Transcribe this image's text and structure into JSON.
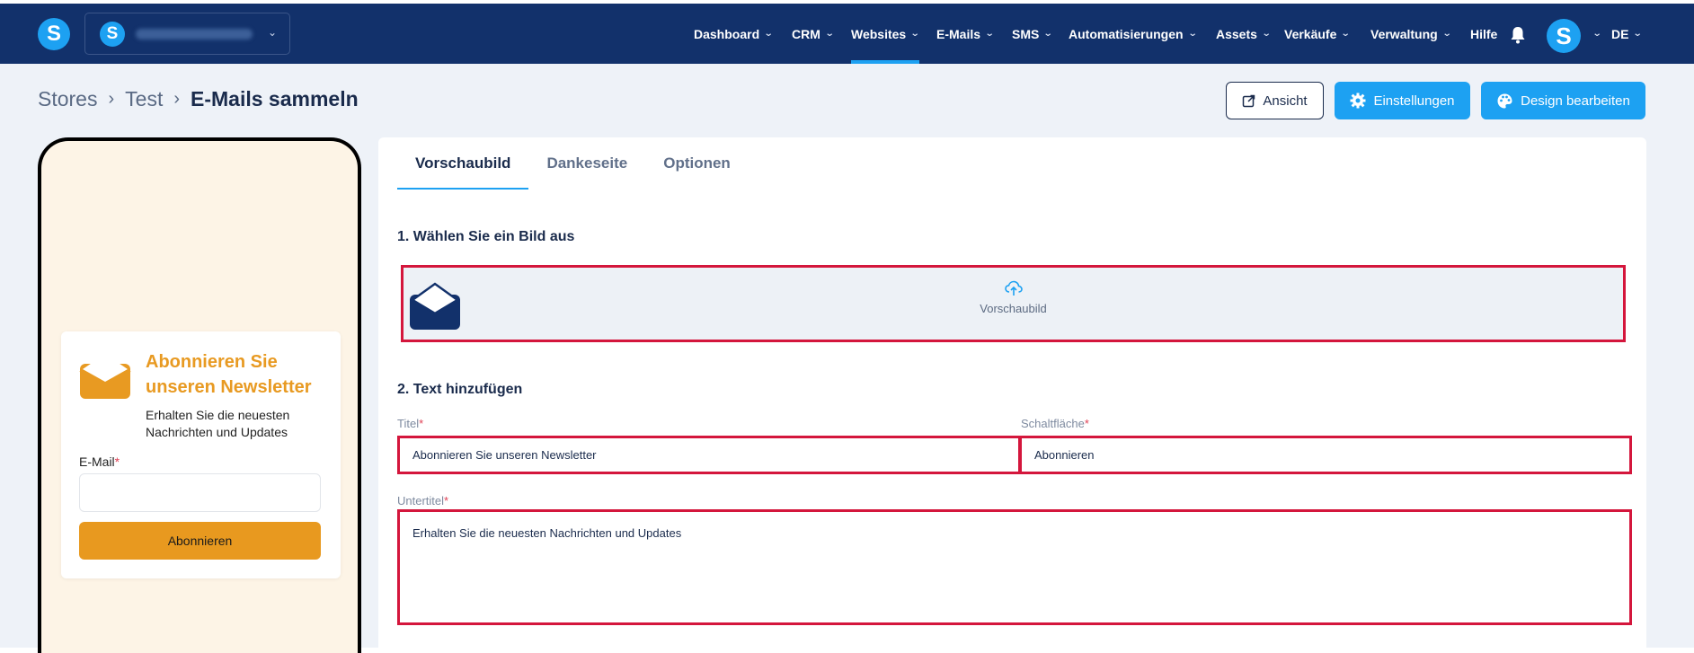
{
  "nav": {
    "logo_letter": "S",
    "account_letter": "S",
    "items": [
      {
        "label": "Dashboard"
      },
      {
        "label": "CRM"
      },
      {
        "label": "Websites"
      },
      {
        "label": "E-Mails"
      },
      {
        "label": "SMS"
      },
      {
        "label": "Automatisierungen"
      },
      {
        "label": "Assets"
      },
      {
        "label": "Verkäufe"
      },
      {
        "label": "Verwaltung"
      }
    ],
    "help_label": "Hilfe",
    "avatar_letter": "S",
    "language": "DE",
    "active_item": "Websites"
  },
  "breadcrumb": {
    "items": [
      "Stores",
      "Test",
      "E-Mails sammeln"
    ]
  },
  "actions": {
    "view_label": "Ansicht",
    "settings_label": "Einstellungen",
    "design_label": "Design bearbeiten"
  },
  "preview": {
    "title": "Abonnieren Sie unseren Newsletter",
    "subtitle": "Erhalten Sie die neuesten Nachrichten und Updates",
    "email_label": "E-Mail",
    "required_mark": "*",
    "button_label": "Abonnieren"
  },
  "editor": {
    "tabs": [
      {
        "label": "Vorschaubild"
      },
      {
        "label": "Dankeseite"
      },
      {
        "label": "Optionen"
      }
    ],
    "active_tab": "Vorschaubild",
    "section1_title": "1. Wählen Sie ein Bild aus",
    "upload_label": "Vorschaubild",
    "section2_title": "2. Text hinzufügen",
    "title_label": "Titel",
    "title_value": "Abonnieren Sie unseren Newsletter",
    "button_field_label": "Schaltfläche",
    "button_field_value": "Abonnieren",
    "subtitle_label": "Untertitel",
    "subtitle_value": "Erhalten Sie die neuesten Nachrichten und Updates",
    "required_mark": "*"
  },
  "colors": {
    "nav_bg": "#12316b",
    "accent_blue": "#1da1f2",
    "newsletter_orange": "#e8991f",
    "highlight_red": "#d4163c",
    "page_bg": "#eef2f8"
  }
}
